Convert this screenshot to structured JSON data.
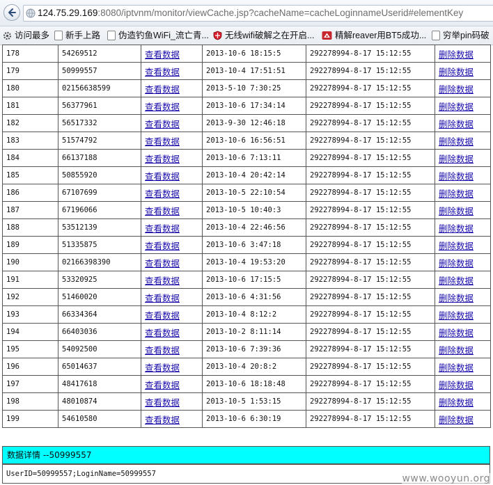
{
  "browser": {
    "url_host": "124.75.29.169",
    "url_rest": ":8080/iptvnm/monitor/viewCache.jsp?cacheName=cacheLoginnameUserid#elementKey"
  },
  "bookmarks": [
    {
      "label": "访问最多",
      "icon": "gear-icon"
    },
    {
      "label": "新手上路",
      "icon": "page-icon"
    },
    {
      "label": "伪造钓鱼WiFi_流亡青...",
      "icon": "page-icon"
    },
    {
      "label": "无线wifi破解之在开启...",
      "icon": "shield-icon"
    },
    {
      "label": "精解reaver用BT5成功...",
      "icon": "fox-icon"
    },
    {
      "label": "穷举pin码破",
      "icon": "page-icon"
    }
  ],
  "table": {
    "view_label": "查看数据",
    "delete_label": "删除数据",
    "rows": [
      {
        "id": "178",
        "key": "54269512",
        "time": "2013-10-6 18:15:5",
        "value": "292278994-8-17 15:12:55"
      },
      {
        "id": "179",
        "key": "50999557",
        "time": "2013-10-4 17:51:51",
        "value": "292278994-8-17 15:12:55"
      },
      {
        "id": "180",
        "key": "02156638599",
        "time": "2013-5-10 7:30:25",
        "value": "292278994-8-17 15:12:55"
      },
      {
        "id": "181",
        "key": "56377961",
        "time": "2013-10-6 17:34:14",
        "value": "292278994-8-17 15:12:55"
      },
      {
        "id": "182",
        "key": "56517332",
        "time": "2013-9-30 12:46:18",
        "value": "292278994-8-17 15:12:55"
      },
      {
        "id": "183",
        "key": "51574792",
        "time": "2013-10-6 16:56:51",
        "value": "292278994-8-17 15:12:55"
      },
      {
        "id": "184",
        "key": "66137188",
        "time": "2013-10-6 7:13:11",
        "value": "292278994-8-17 15:12:55"
      },
      {
        "id": "185",
        "key": "50855920",
        "time": "2013-10-4 20:42:14",
        "value": "292278994-8-17 15:12:55"
      },
      {
        "id": "186",
        "key": "67107699",
        "time": "2013-10-5 22:10:54",
        "value": "292278994-8-17 15:12:55"
      },
      {
        "id": "187",
        "key": "67196066",
        "time": "2013-10-5 10:40:3",
        "value": "292278994-8-17 15:12:55"
      },
      {
        "id": "188",
        "key": "53512139",
        "time": "2013-10-4 22:46:56",
        "value": "292278994-8-17 15:12:55"
      },
      {
        "id": "189",
        "key": "51335875",
        "time": "2013-10-6 3:47:18",
        "value": "292278994-8-17 15:12:55"
      },
      {
        "id": "190",
        "key": "02166398390",
        "time": "2013-10-4 19:53:20",
        "value": "292278994-8-17 15:12:55"
      },
      {
        "id": "191",
        "key": "53320925",
        "time": "2013-10-6 17:15:5",
        "value": "292278994-8-17 15:12:55"
      },
      {
        "id": "192",
        "key": "51460020",
        "time": "2013-10-6 4:31:56",
        "value": "292278994-8-17 15:12:55"
      },
      {
        "id": "193",
        "key": "66334364",
        "time": "2013-10-4 8:12:2",
        "value": "292278994-8-17 15:12:55"
      },
      {
        "id": "194",
        "key": "66403036",
        "time": "2013-10-2 8:11:14",
        "value": "292278994-8-17 15:12:55"
      },
      {
        "id": "195",
        "key": "54092500",
        "time": "2013-10-6 7:39:36",
        "value": "292278994-8-17 15:12:55"
      },
      {
        "id": "196",
        "key": "65014637",
        "time": "2013-10-4 20:8:2",
        "value": "292278994-8-17 15:12:55"
      },
      {
        "id": "197",
        "key": "48417618",
        "time": "2013-10-6 18:18:48",
        "value": "292278994-8-17 15:12:55"
      },
      {
        "id": "198",
        "key": "48010874",
        "time": "2013-10-5 1:53:15",
        "value": "292278994-8-17 15:12:55"
      },
      {
        "id": "199",
        "key": "54610580",
        "time": "2013-10-6 6:30:19",
        "value": "292278994-8-17 15:12:55"
      }
    ]
  },
  "detail": {
    "header": "数据详情 --50999557",
    "content": "UserID=50999557;LoginName=50999557"
  },
  "watermark": "www.wooyun.org",
  "colors": {
    "detail_bar": "#00ffff",
    "link": "#1a0dab"
  }
}
